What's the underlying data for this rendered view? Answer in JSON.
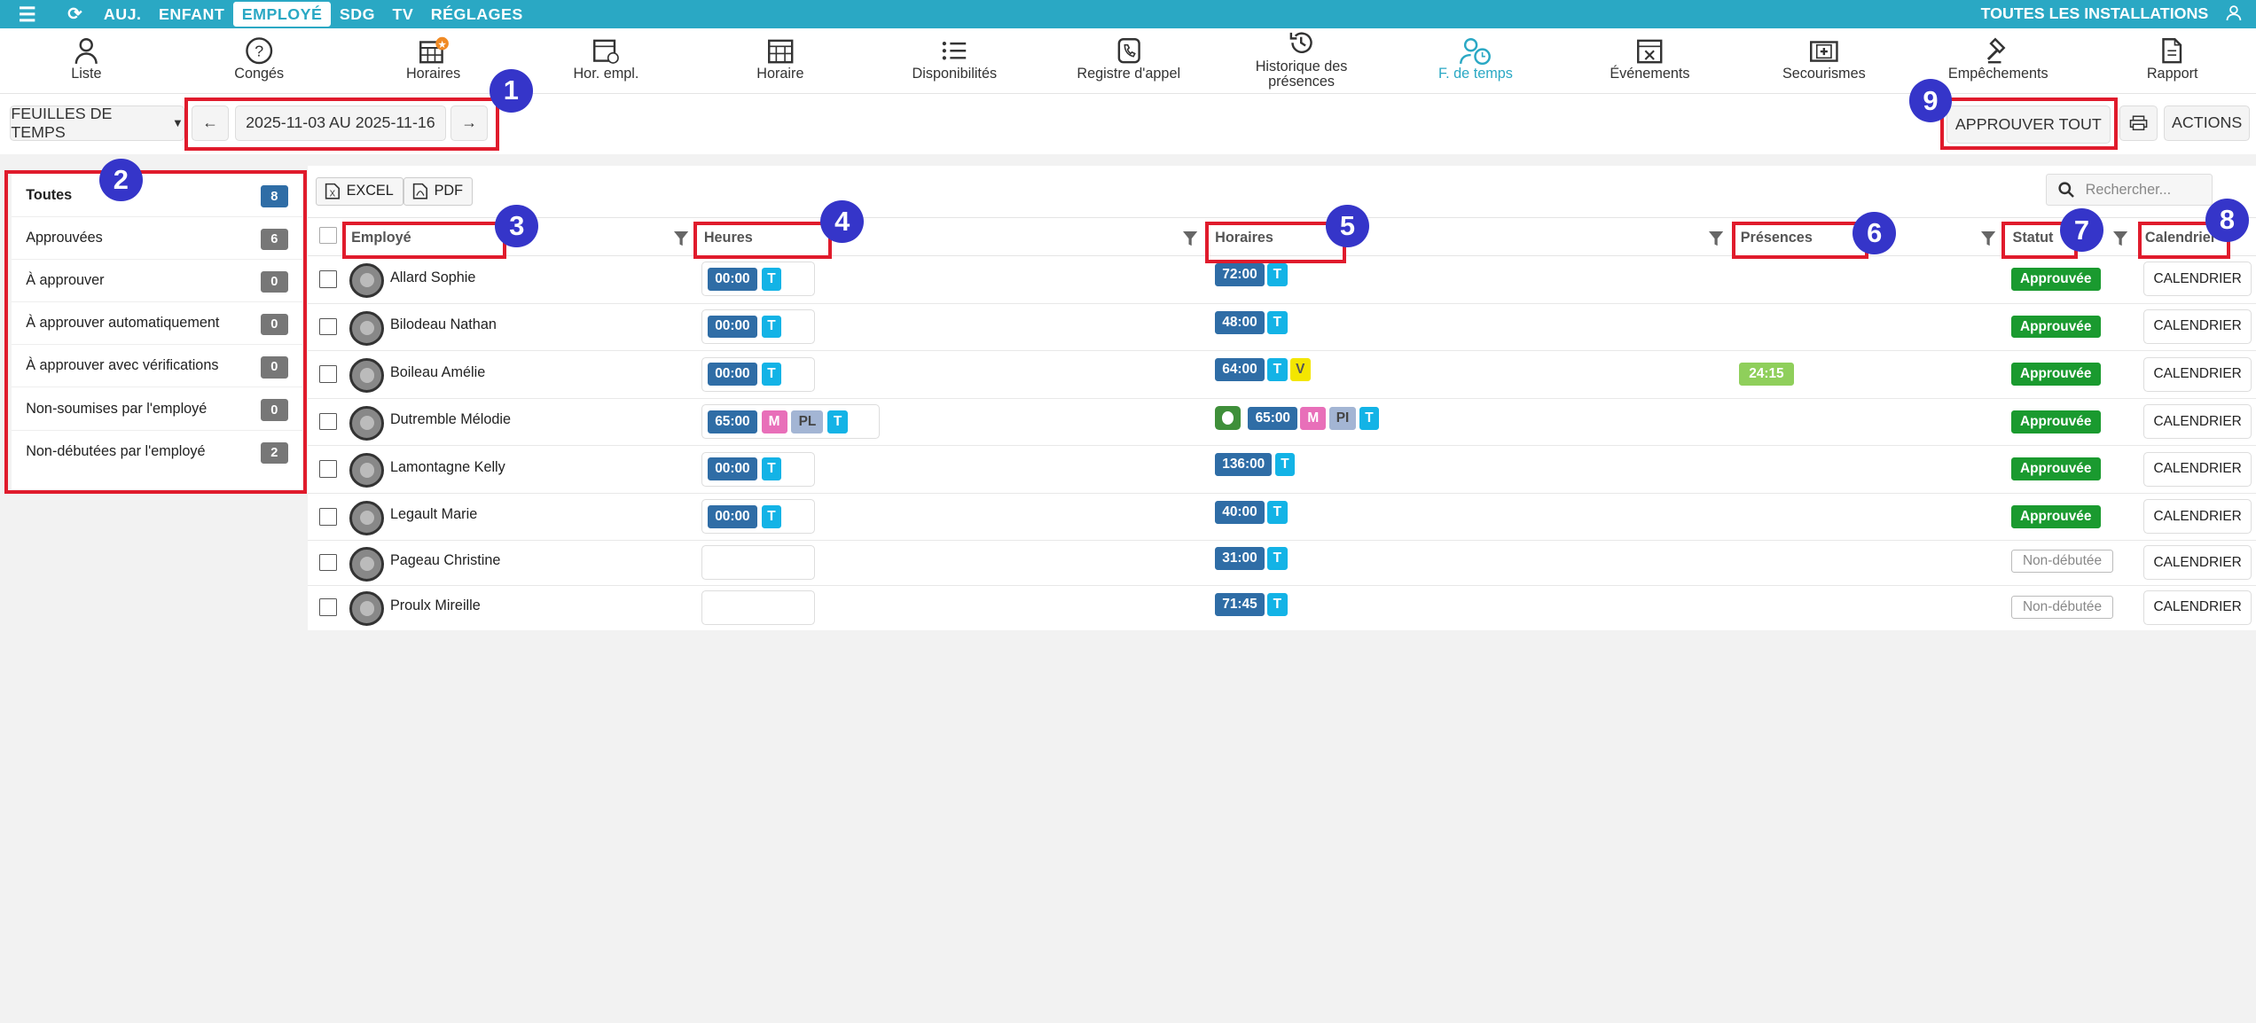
{
  "topbar": {
    "tabs": [
      {
        "label": "AUJ."
      },
      {
        "label": "ENFANT"
      },
      {
        "label": "EMPLOYÉ"
      },
      {
        "label": "SDG"
      },
      {
        "label": "TV"
      },
      {
        "label": "RÉGLAGES"
      }
    ],
    "right_label": "TOUTES LES INSTALLATIONS"
  },
  "iconbar": {
    "items": [
      {
        "label": "Liste",
        "icon": "person-icon"
      },
      {
        "label": "Congés",
        "icon": "help-circle-icon"
      },
      {
        "label": "Horaires",
        "icon": "calendar-grid-icon"
      },
      {
        "label": "Hor. empl.",
        "icon": "calendar-person-icon"
      },
      {
        "label": "Horaire",
        "icon": "calendar-icon"
      },
      {
        "label": "Disponibilités",
        "icon": "list-icon"
      },
      {
        "label": "Registre d'appel",
        "icon": "phone-icon"
      },
      {
        "label": "Historique des présences",
        "icon": "history-icon"
      },
      {
        "label": "F. de temps",
        "icon": "timesheet-icon"
      },
      {
        "label": "Événements",
        "icon": "calendar-x-icon"
      },
      {
        "label": "Secourismes",
        "icon": "first-aid-icon"
      },
      {
        "label": "Empêchements",
        "icon": "gavel-icon"
      },
      {
        "label": "Rapport",
        "icon": "document-icon"
      }
    ]
  },
  "controls": {
    "type_select": "FEUILLES DE TEMPS",
    "date_range": "2025-11-03 AU 2025-11-16",
    "approve_all": "APPROUVER TOUT",
    "actions": "ACTIONS"
  },
  "sidebar": {
    "items": [
      {
        "label": "Toutes",
        "count": "8"
      },
      {
        "label": "Approuvées",
        "count": "6"
      },
      {
        "label": "À approuver",
        "count": "0"
      },
      {
        "label": "À approuver automatiquement",
        "count": "0"
      },
      {
        "label": "À approuver avec vérifications",
        "count": "0"
      },
      {
        "label": "Non-soumises par l'employé",
        "count": "0"
      },
      {
        "label": "Non-débutées par l'employé",
        "count": "2"
      }
    ]
  },
  "toolbar": {
    "excel": "EXCEL",
    "pdf": "PDF",
    "search_placeholder": "Rechercher..."
  },
  "table": {
    "headers": {
      "employee": "Employé",
      "hours": "Heures",
      "schedules": "Horaires",
      "presences": "Présences",
      "status": "Statut",
      "calendar": "Calendrier"
    },
    "rows": [
      {
        "name": "Allard Sophie",
        "hours": "00:00",
        "schedule": "72:00",
        "status": "Approuvée",
        "calendar": "CALENDRIER"
      },
      {
        "name": "Bilodeau Nathan",
        "hours": "00:00",
        "schedule": "48:00",
        "status": "Approuvée",
        "calendar": "CALENDRIER"
      },
      {
        "name": "Boileau Amélie",
        "hours": "00:00",
        "schedule": "64:00",
        "schedule_extra": "V",
        "presence": "24:15",
        "status": "Approuvée",
        "calendar": "CALENDRIER"
      },
      {
        "name": "Dutremble Mélodie",
        "hours": "65:00",
        "hours_m": "M",
        "hours_pl": "PL",
        "schedule": "65:00",
        "schedule_m": "M",
        "schedule_pl": "PI",
        "status": "Approuvée",
        "calendar": "CALENDRIER"
      },
      {
        "name": "Lamontagne Kelly",
        "hours": "00:00",
        "schedule": "136:00",
        "status": "Approuvée",
        "calendar": "CALENDRIER"
      },
      {
        "name": "Legault Marie",
        "hours": "00:00",
        "schedule": "40:00",
        "status": "Approuvée",
        "calendar": "CALENDRIER"
      },
      {
        "name": "Pageau Christine",
        "hours": "",
        "schedule": "31:00",
        "status": "Non-débutée",
        "calendar": "CALENDRIER"
      },
      {
        "name": "Proulx Mireille",
        "hours": "",
        "schedule": "71:45",
        "status": "Non-débutée",
        "calendar": "CALENDRIER"
      }
    ],
    "tag_t": "T"
  },
  "callouts": [
    "1",
    "2",
    "3",
    "4",
    "5",
    "6",
    "7",
    "8",
    "9"
  ],
  "colors": {
    "accent": "#2aa8c4",
    "callout": "#3535c9",
    "highlight": "#e01b2c",
    "approved": "#1a9a2f"
  }
}
